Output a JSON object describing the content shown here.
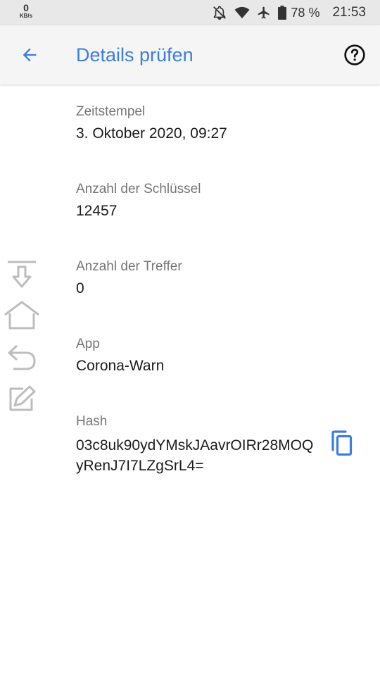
{
  "status_bar": {
    "net_speed": "0",
    "net_unit": "KB/s",
    "battery": "78 %",
    "time": "21:53"
  },
  "app_bar": {
    "title": "Details prüfen",
    "back_icon": "arrow-left-icon",
    "help_icon": "help-circle-icon"
  },
  "details": [
    {
      "label": "Zeitstempel",
      "value": "3. Oktober 2020, 09:27"
    },
    {
      "label": "Anzahl der Schlüssel",
      "value": "12457"
    },
    {
      "label": "Anzahl der Treffer",
      "value": "0"
    },
    {
      "label": "App",
      "value": "Corona-Warn"
    }
  ],
  "hash": {
    "label": "Hash",
    "value": "03c8uk90ydYMskJAavrOIRr28MOQyRenJ7I7LZgSrL4=",
    "copy_icon": "copy-icon"
  },
  "side_toolbar": {
    "icons": [
      "download-icon",
      "home-icon",
      "undo-icon",
      "share-edit-icon"
    ]
  },
  "colors": {
    "accent": "#3d7de0",
    "status_bar_bg": "#e8e8e8",
    "app_bar_bg": "#f5f5f5",
    "label_gray": "#757575",
    "value_text": "#1b1b1b",
    "side_icon_gray": "#bdbdbd"
  }
}
